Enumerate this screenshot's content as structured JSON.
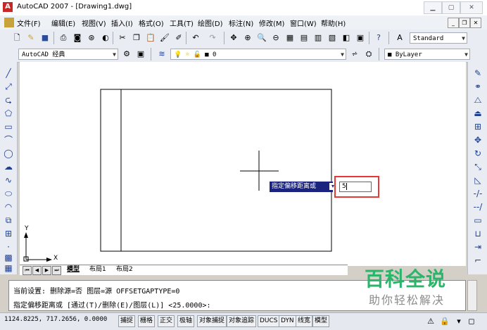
{
  "window": {
    "title": "AutoCAD 2007 - [Drawing1.dwg]"
  },
  "menu": [
    "文件(F)",
    "编辑(E)",
    "视图(V)",
    "插入(I)",
    "格式(O)",
    "工具(T)",
    "绘图(D)",
    "标注(N)",
    "修改(M)",
    "窗口(W)",
    "帮助(H)"
  ],
  "toolbar": {
    "text_style": "Standard",
    "workspace": "AutoCAD 经典",
    "layer": "0",
    "color": "ByLayer"
  },
  "tabs": [
    "模型",
    "布局1",
    "布局2"
  ],
  "ucs": {
    "x": "X",
    "y": "Y"
  },
  "dynamic_input": {
    "prompt": "指定偏移距离或",
    "value": "5"
  },
  "command": {
    "line1": "当前设置: 删除源=否  图层=源  OFFSETGAPTYPE=0",
    "line2": "指定偏移距离或 [通过(T)/删除(E)/图层(L)] <25.0000>:"
  },
  "status": {
    "coords": "1124.8225, 717.2656, 0.0000",
    "toggles": [
      "捕捉",
      "栅格",
      "正交",
      "极轴",
      "对象捕捉",
      "对象追踪",
      "DUCS",
      "DYN",
      "线宽",
      "模型"
    ]
  },
  "watermark": {
    "title": "百科全说",
    "subtitle": "助你轻松解决"
  },
  "colors": {
    "accent_red": "#e53935",
    "tooltip_bg": "#1a237e",
    "watermark_green": "#2bb56b"
  }
}
